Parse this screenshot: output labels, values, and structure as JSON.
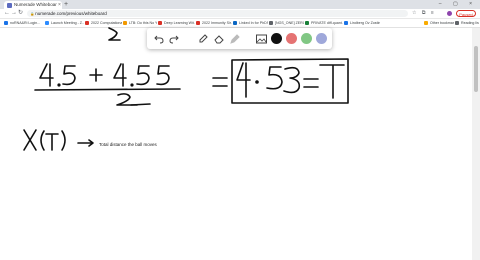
{
  "browser": {
    "tab_title": "Numerade Whiteboard",
    "tab_close": "×",
    "new_tab": "+",
    "window_controls": "– ▢ ×",
    "back": "←",
    "forward": "→",
    "reload": "↻",
    "url": "numerade.com/previous/whiteboard",
    "lock": "🔒",
    "toolbar_icons": "☆ ⧉ ≡",
    "paused_label": "Paused",
    "bookmarks": [
      {
        "label": "noRNA&Ri Login...",
        "color": "#1a73e8"
      },
      {
        "label": "Launch Meeting - Z...",
        "color": "#2d8cff"
      },
      {
        "label": "2022 Computational...",
        "color": "#d93025"
      },
      {
        "label": "LTB: Do this No Ye...",
        "color": "#f29900"
      },
      {
        "label": "Deep Learning Wit...",
        "color": "#d93025"
      },
      {
        "label": "2022 Immunity Sir...",
        "color": "#d93025"
      },
      {
        "label": "Linked In for PhDS...",
        "color": "#0a66c2"
      },
      {
        "label": "[NGS_ONE] ZERO",
        "color": "#5f6368"
      },
      {
        "label": "PRIVATE diff-quant...",
        "color": "#188038"
      },
      {
        "label": "Lindberg Ov Zostin...",
        "color": "#1a73e8"
      },
      {
        "label": "Other bookmarks",
        "color": "#f9ab00"
      },
      {
        "label": "Reading list",
        "color": "#5f6368"
      }
    ]
  },
  "whiteboard": {
    "tools": {
      "undo": "undo-icon",
      "redo": "redo-icon",
      "pen": "pen-icon",
      "eraser": "eraser-icon",
      "highlighter": "highlighter-icon",
      "image": "image-icon"
    },
    "colors": [
      "#111111",
      "#e57373",
      "#81c784",
      "#9fa8da"
    ],
    "annotation": "Total distance the ball moves"
  }
}
